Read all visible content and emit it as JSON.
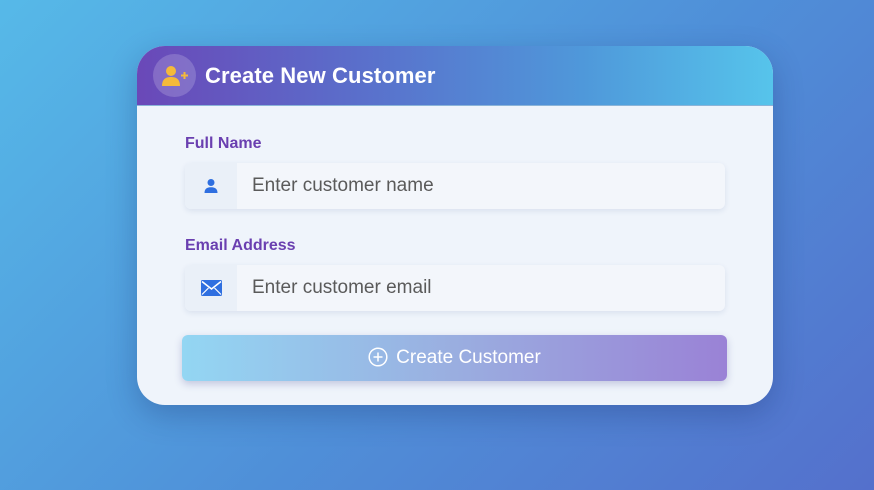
{
  "form": {
    "title": "Create New Customer",
    "header_icon": "user-plus-icon",
    "fields": {
      "name": {
        "label": "Full Name",
        "placeholder": "Enter customer name",
        "value": "",
        "icon": "user-icon"
      },
      "email": {
        "label": "Email Address",
        "placeholder": "Enter customer email",
        "value": "",
        "icon": "envelope-icon"
      }
    },
    "submit": {
      "label": "Create Customer",
      "icon": "plus-circle-icon"
    }
  },
  "colors": {
    "accent_purple": "#6a3fb0",
    "icon_blue": "#2f6fe0",
    "header_icon_yellow": "#f5b93a"
  }
}
